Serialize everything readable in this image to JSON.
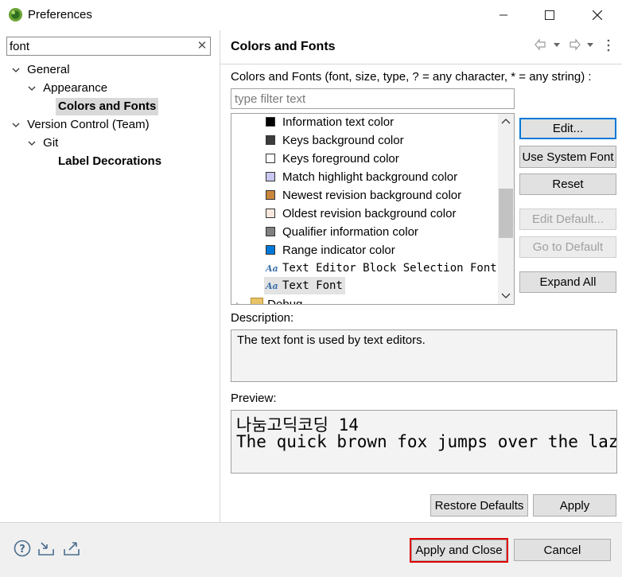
{
  "window": {
    "title": "Preferences",
    "controls": {
      "minimize": "—",
      "maximize": "☐",
      "close": "✕"
    }
  },
  "left": {
    "filter_value": "font",
    "filter_clear": "✕",
    "tree": [
      {
        "label": "General",
        "level": 0,
        "expanded": true
      },
      {
        "label": "Appearance",
        "level": 1,
        "expanded": true
      },
      {
        "label": "Colors and Fonts",
        "level": 2,
        "selected": true
      },
      {
        "label": "Version Control (Team)",
        "level": 0,
        "expanded": true
      },
      {
        "label": "Git",
        "level": 1,
        "expanded": true
      },
      {
        "label": "Label Decorations",
        "level": 2
      }
    ]
  },
  "right": {
    "title": "Colors and Fonts",
    "description": "Colors and Fonts (font, size, type, ? = any character, * = any string) :",
    "filter_placeholder": "type filter text",
    "items": [
      {
        "label": "Information text color",
        "kind": "color",
        "color": "#000000"
      },
      {
        "label": "Keys background color",
        "kind": "color",
        "color": "#3c3c3c"
      },
      {
        "label": "Keys foreground color",
        "kind": "color",
        "color": "#ffffff"
      },
      {
        "label": "Match highlight background color",
        "kind": "color",
        "color": "#c8c8f0"
      },
      {
        "label": "Newest revision background color",
        "kind": "color",
        "color": "#c8873c"
      },
      {
        "label": "Oldest revision background color",
        "kind": "color",
        "color": "#f7e7dc"
      },
      {
        "label": "Qualifier information color",
        "kind": "color",
        "color": "#808080"
      },
      {
        "label": "Range indicator color",
        "kind": "color",
        "color": "#0078d7"
      },
      {
        "label": "Text Editor Block Selection Font",
        "kind": "font"
      },
      {
        "label": "Text Font",
        "kind": "font",
        "selected": true
      },
      {
        "label": "Debug",
        "kind": "folder"
      }
    ],
    "buttons": {
      "edit": "Edit...",
      "use_system_font": "Use System Font",
      "reset": "Reset",
      "edit_default": "Edit Default...",
      "go_to_default": "Go to Default",
      "expand_all": "Expand All"
    },
    "description_label": "Description:",
    "description_text": "The text font is used by text editors.",
    "preview_label": "Preview:",
    "preview_lines": [
      "나눔고딕코딩 14",
      "The quick brown fox jumps over the lazy dog."
    ],
    "restore_defaults": "Restore Defaults",
    "apply": "Apply"
  },
  "bottom": {
    "apply_and_close": "Apply and Close",
    "cancel": "Cancel"
  }
}
